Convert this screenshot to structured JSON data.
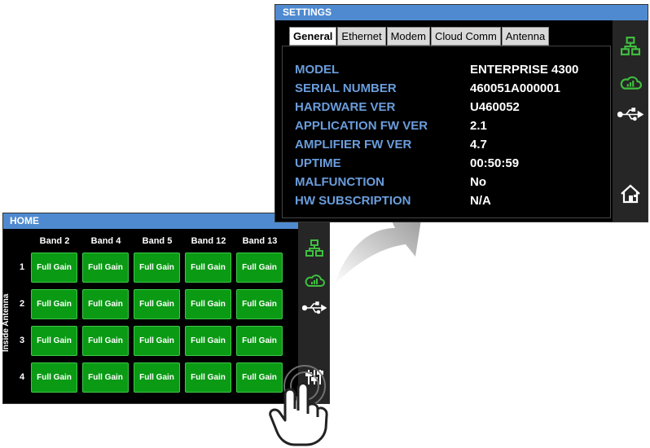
{
  "home": {
    "title": "HOME",
    "side_label": "Inside Antenna",
    "bands": [
      "Band 2",
      "Band 4",
      "Band 5",
      "Band 12",
      "Band 13"
    ],
    "rows": [
      "1",
      "2",
      "3",
      "4"
    ],
    "cell_label": "Full Gain",
    "nav_icons": [
      "network-icon",
      "cloud-signal-icon",
      "usb-icon",
      "sliders-icon"
    ]
  },
  "settings": {
    "title": "SETTINGS",
    "tabs": [
      "General",
      "Ethernet",
      "Modem",
      "Cloud Comm",
      "Antenna"
    ],
    "active_tab": "General",
    "info": [
      {
        "key": "MODEL",
        "value": "ENTERPRISE 4300"
      },
      {
        "key": "SERIAL NUMBER",
        "value": "460051A000001"
      },
      {
        "key": "HARDWARE VER",
        "value": "U460052"
      },
      {
        "key": "APPLICATION FW VER",
        "value": "2.1"
      },
      {
        "key": "AMPLIFIER FW VER",
        "value": "4.7"
      },
      {
        "key": "UPTIME",
        "value": "00:50:59"
      },
      {
        "key": "MALFUNCTION",
        "value": "No"
      },
      {
        "key": "HW SUBSCRIPTION",
        "value": "N/A"
      }
    ],
    "nav_icons": [
      "network-icon",
      "cloud-signal-icon",
      "usb-icon",
      "home-icon"
    ]
  },
  "colors": {
    "title_bar": "#4f8ad0",
    "cell_green": "#0a9a14",
    "label_blue": "#6a9ddc",
    "icon_green": "#3fbf3f",
    "sidebar": "#262626"
  }
}
